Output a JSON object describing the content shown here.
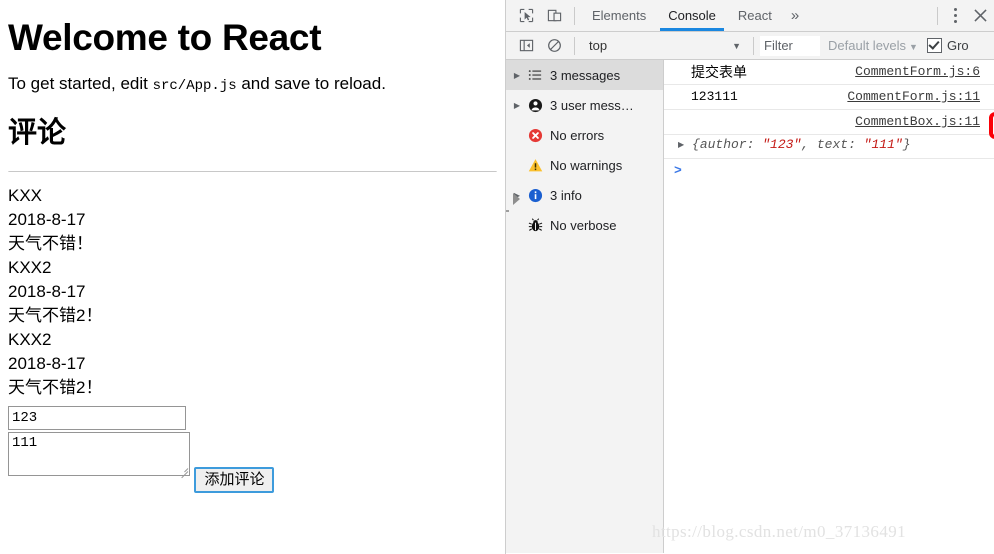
{
  "page": {
    "title": "Welcome to React",
    "intro_before": "To get started, edit ",
    "intro_code": "src/App.js",
    "intro_after": " and save to reload.",
    "comments_heading": "评论",
    "comments": [
      {
        "author": "KXX",
        "date": "2018-8-17",
        "text": "天气不错！"
      },
      {
        "author": "KXX2",
        "date": "2018-8-17",
        "text": "天气不错2！"
      },
      {
        "author": "KXX2",
        "date": "2018-8-17",
        "text": "天气不错2！"
      }
    ],
    "form": {
      "author_value": "123",
      "author_placeholder": "",
      "text_value": "111",
      "text_placeholder": "",
      "submit_label": "添加评论"
    }
  },
  "devtools": {
    "tabs": [
      {
        "label": "Elements",
        "active": false
      },
      {
        "label": "Console",
        "active": true
      },
      {
        "label": "React",
        "active": false
      }
    ],
    "more_tabs_label": "»",
    "inspect_icon": "inspect-element-icon",
    "device_icon": "device-toolbar-icon",
    "menu_icon": "kebab-menu-icon",
    "close_icon": "close-icon",
    "filterbar": {
      "sidebar_toggle_icon": "console-sidebar-toggle-icon",
      "clear_icon": "clear-console-icon",
      "context_value": "top",
      "context_caret": "▼",
      "filter_placeholder": "Filter",
      "filter_value": "",
      "levels_label": "Default levels",
      "levels_caret": "▼",
      "group_similar_label": "Gro",
      "group_similar_checked": true
    },
    "sidebar": [
      {
        "label": "3 messages",
        "icon": "list-icon",
        "expandable": true,
        "selected": true
      },
      {
        "label": "3 user mess…",
        "icon": "person-icon",
        "expandable": true,
        "selected": false
      },
      {
        "label": "No errors",
        "icon": "error-icon",
        "expandable": false,
        "selected": false
      },
      {
        "label": "No warnings",
        "icon": "warning-icon",
        "expandable": false,
        "selected": false
      },
      {
        "label": "3 info",
        "icon": "info-icon",
        "expandable": true,
        "selected": false
      },
      {
        "label": "No verbose",
        "icon": "bug-icon",
        "expandable": false,
        "selected": false
      }
    ],
    "messages": [
      {
        "text": "提交表单",
        "cjk": true,
        "source": "CommentForm.js:6"
      },
      {
        "text": "123111",
        "cjk": false,
        "source": "CommentForm.js:11"
      },
      {
        "text": "",
        "cjk": false,
        "source": "CommentBox.js:11",
        "highlighted": true
      }
    ],
    "object_preview": {
      "arrow": "▶",
      "open": "{",
      "key1": "author: ",
      "val1": "\"123\"",
      "sep": ", ",
      "key2": "text: ",
      "val2": "\"111\"",
      "close": "}"
    },
    "prompt_caret": ">",
    "highlight_color": "#fb0007",
    "accent_color": "#1a87e0"
  },
  "watermark": "https://blog.csdn.net/m0_37136491"
}
